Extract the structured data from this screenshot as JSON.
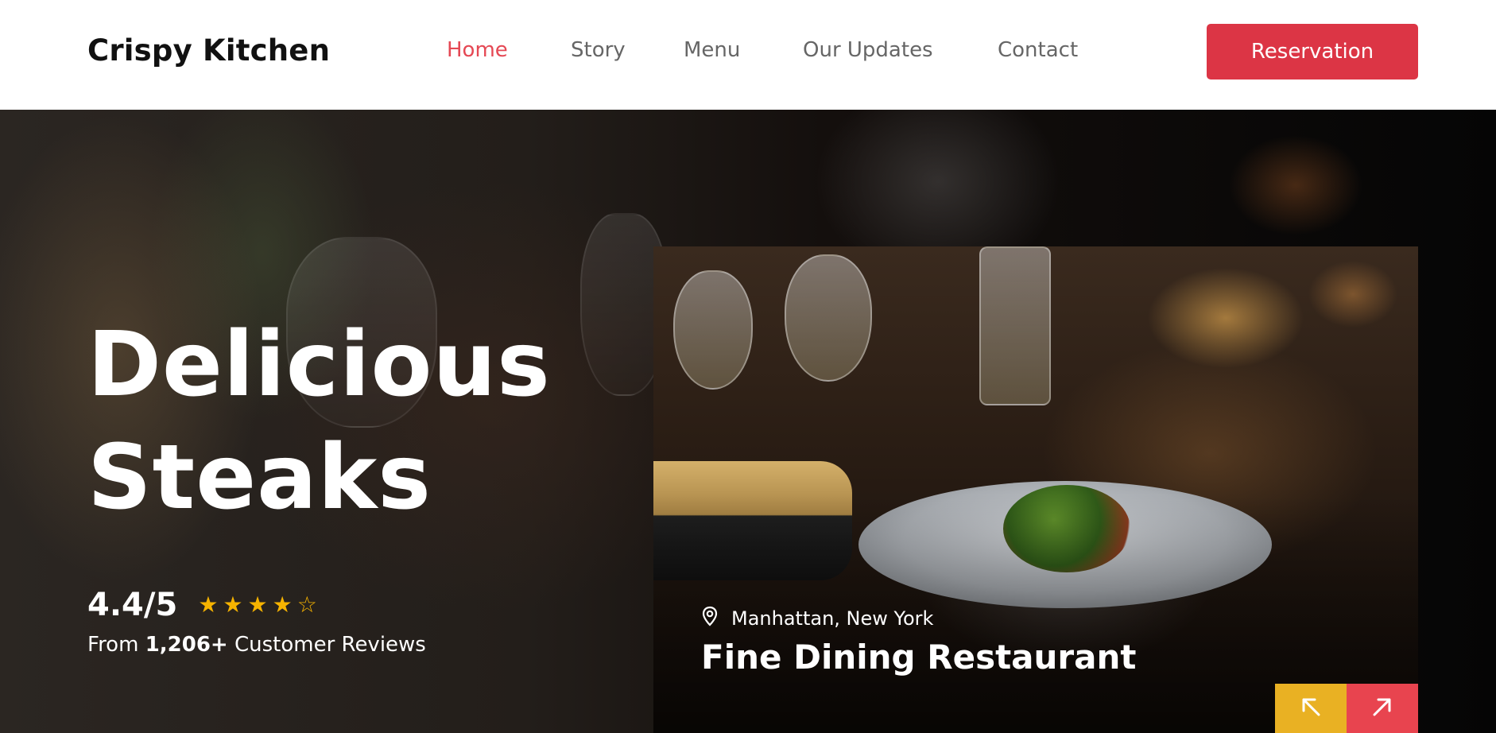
{
  "header": {
    "brand": "Crispy Kitchen",
    "nav": [
      {
        "label": "Home",
        "active": true
      },
      {
        "label": "Story",
        "active": false
      },
      {
        "label": "Menu",
        "active": false
      },
      {
        "label": "Our Updates",
        "active": false
      },
      {
        "label": "Contact",
        "active": false
      }
    ],
    "reservation_label": "Reservation"
  },
  "hero": {
    "title_line1": "Delicious",
    "title_line2": "Steaks",
    "rating": "4.4/5",
    "stars_filled": 4,
    "stars_total": 5,
    "reviews_prefix": "From",
    "reviews_count": "1,206+",
    "reviews_suffix": "Customer Reviews"
  },
  "card": {
    "location_icon": "map-pin-icon",
    "location": "Manhattan, New York",
    "title": "Fine Dining Restaurant",
    "prev_icon": "arrow-up-left-icon",
    "next_icon": "arrow-up-right-icon"
  },
  "colors": {
    "accent_red": "#dc3545",
    "nav_active": "#e54854",
    "star": "#f6b300",
    "prev_button": "#e9b123",
    "next_button": "#e8444f"
  }
}
